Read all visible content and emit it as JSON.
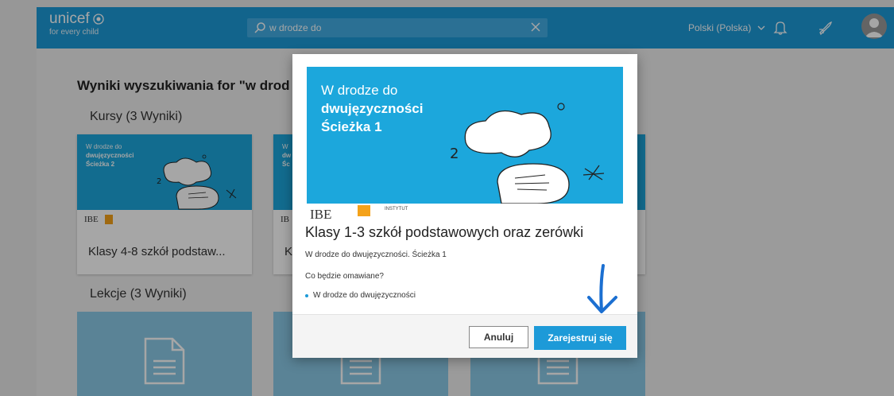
{
  "header": {
    "logo_main": "unicef",
    "logo_sub": "for every child",
    "search_value": "w drodze do",
    "language": "Polski (Polska)"
  },
  "results": {
    "title": "Wyniki wyszukiwania for \"w drod",
    "courses_heading": "Kursy (3 Wyniki)",
    "lessons_heading": "Lekcje (3 Wyniki)",
    "courses": [
      {
        "thumb_line1": "W drodze do",
        "thumb_line2": "dwujęzyczności",
        "thumb_line3": "Ścieżka 2",
        "logo": "IBE",
        "name": "Klasy 4-8 szkół podstaw..."
      },
      {
        "thumb_line1": "W",
        "thumb_line2": "dw",
        "thumb_line3": "Śc",
        "logo": "IB",
        "name": "K"
      }
    ]
  },
  "modal": {
    "thumb_line1": "W drodze do",
    "thumb_line2": "dwujęzyczności",
    "thumb_line3": "Ścieżka 1",
    "strip_logo": "IBE",
    "strip_institute": "INSTYTUT",
    "title": "Klasy 1-3 szkół podstawowych oraz zerówki",
    "subtitle": "W drodze do dwujęzyczności. Ścieżka 1",
    "question": "Co będzie omawiane?",
    "bullet": "W drodze do dwujęzyczności",
    "cancel_label": "Anuluj",
    "register_label": "Zarejestruj się"
  },
  "colors": {
    "brand": "#1d9ad8",
    "thumb": "#1ca7dc",
    "annotation": "#1b6fd1"
  },
  "icons": [
    "unicef-logo-icon",
    "search-icon",
    "clear-icon",
    "chevron-down-icon",
    "bell-icon",
    "rocket-icon",
    "avatar-icon",
    "document-icon",
    "arrow-down-annotation"
  ]
}
